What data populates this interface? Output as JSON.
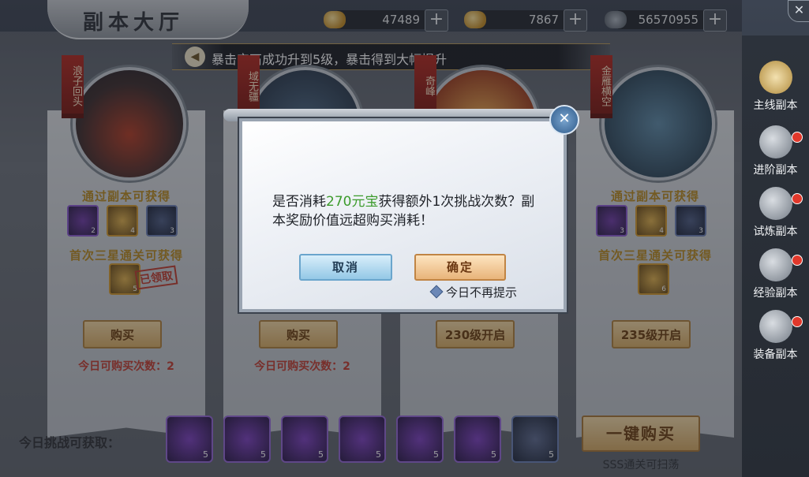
{
  "header": {
    "title": "副本大厅",
    "currencies": [
      {
        "icon": "gold-ingot-icon",
        "value": "47489"
      },
      {
        "icon": "bound-gold-icon",
        "value": "7867"
      },
      {
        "icon": "coin-icon",
        "value": "56570955"
      }
    ]
  },
  "notice": {
    "text": "暴击宝石成功升到5级，暴击得到大幅提升"
  },
  "cards": [
    {
      "banner": "浪子回头",
      "reward_title": "通过副本可获得",
      "first_title": "首次三星通关可获得",
      "items": [
        "2",
        "4",
        "3"
      ],
      "first_item": "5",
      "stamp": "已领取",
      "button": "购买",
      "count": "今日可购买次数：2"
    },
    {
      "banner": "域无疆",
      "reward_title": "",
      "first_title": "",
      "items": [],
      "first_item": "",
      "stamp": "",
      "button": "购买",
      "count": "今日可购买次数：2"
    },
    {
      "banner": "奇峰",
      "reward_title": "",
      "first_title": "",
      "items": [],
      "first_item": "",
      "stamp": "",
      "button": "230级开启",
      "count": ""
    },
    {
      "banner": "金雁横空",
      "reward_title": "通过副本可获得",
      "first_title": "首次三星通关可获得",
      "items": [
        "3",
        "4",
        "3"
      ],
      "first_item": "6",
      "stamp": "",
      "button": "235级开启",
      "count": ""
    }
  ],
  "bottom": {
    "label": "今日挑战可获取：",
    "items": [
      "5",
      "5",
      "5",
      "5",
      "5",
      "5",
      "5"
    ],
    "one_key": "一键购买",
    "sss": "SSS通关可扫荡"
  },
  "side_nav": [
    {
      "label": "主线副本",
      "icon": "flag-icon",
      "dot": false
    },
    {
      "label": "进阶副本",
      "icon": "warrior-icon",
      "dot": true
    },
    {
      "label": "试炼副本",
      "icon": "demon-mask-icon",
      "dot": true
    },
    {
      "label": "经验副本",
      "icon": "dragon-icon",
      "dot": true
    },
    {
      "label": "装备副本",
      "icon": "gear-shield-icon",
      "dot": true
    }
  ],
  "dialog": {
    "message_pre": "是否消耗",
    "message_highlight": "270元宝",
    "message_post": "获得额外1次挑战次数？副本奖励价值远超购买消耗！",
    "cancel": "取消",
    "confirm": "确定",
    "remind": "今日不再提示"
  }
}
